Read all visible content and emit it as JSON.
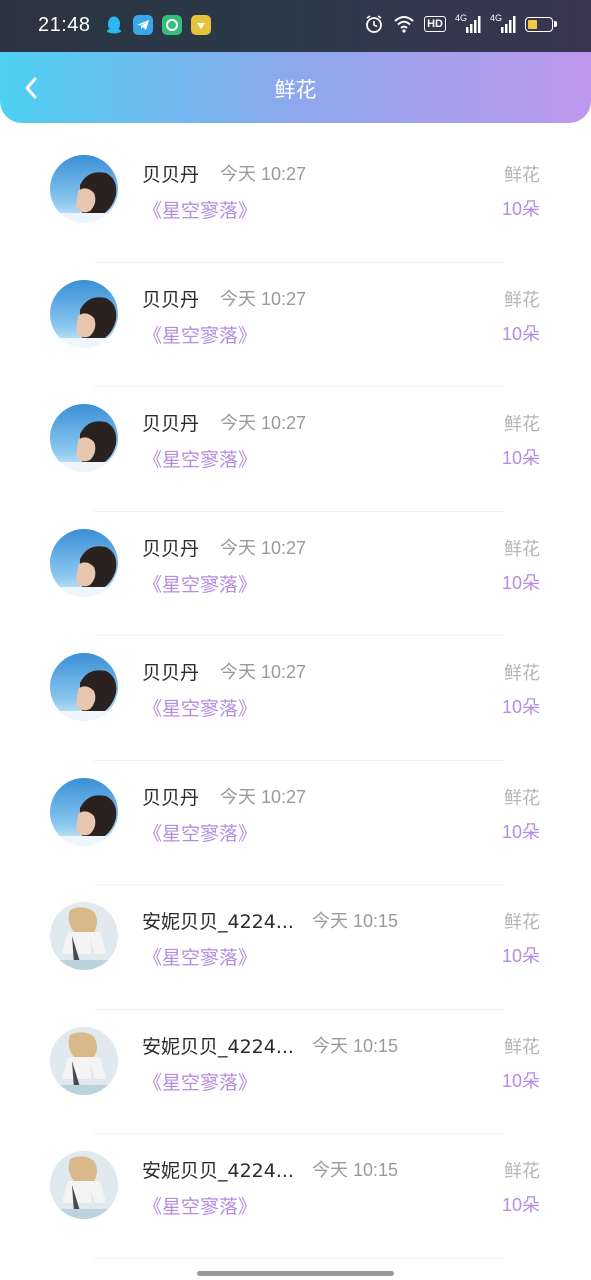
{
  "status_bar": {
    "time": "21:48",
    "hd_label": "HD",
    "network_label_1": "4G",
    "network_label_2": "4G",
    "battery_level": 0.4
  },
  "header": {
    "title": "鲜花",
    "back_icon": "chevron-left-icon"
  },
  "items": [
    {
      "name": "贝贝丹",
      "time": "今天 10:27",
      "work": "《星空寥落》",
      "gift_type": "鲜花",
      "gift_count": "10朵",
      "avatar": "sky"
    },
    {
      "name": "贝贝丹",
      "time": "今天 10:27",
      "work": "《星空寥落》",
      "gift_type": "鲜花",
      "gift_count": "10朵",
      "avatar": "sky"
    },
    {
      "name": "贝贝丹",
      "time": "今天 10:27",
      "work": "《星空寥落》",
      "gift_type": "鲜花",
      "gift_count": "10朵",
      "avatar": "sky"
    },
    {
      "name": "贝贝丹",
      "time": "今天 10:27",
      "work": "《星空寥落》",
      "gift_type": "鲜花",
      "gift_count": "10朵",
      "avatar": "sky"
    },
    {
      "name": "贝贝丹",
      "time": "今天 10:27",
      "work": "《星空寥落》",
      "gift_type": "鲜花",
      "gift_count": "10朵",
      "avatar": "sky"
    },
    {
      "name": "贝贝丹",
      "time": "今天 10:27",
      "work": "《星空寥落》",
      "gift_type": "鲜花",
      "gift_count": "10朵",
      "avatar": "sky"
    },
    {
      "name": "安妮贝贝_4224...",
      "time": "今天 10:15",
      "work": "《星空寥落》",
      "gift_type": "鲜花",
      "gift_count": "10朵",
      "avatar": "girl"
    },
    {
      "name": "安妮贝贝_4224...",
      "time": "今天 10:15",
      "work": "《星空寥落》",
      "gift_type": "鲜花",
      "gift_count": "10朵",
      "avatar": "girl"
    },
    {
      "name": "安妮贝贝_4224...",
      "time": "今天 10:15",
      "work": "《星空寥落》",
      "gift_type": "鲜花",
      "gift_count": "10朵",
      "avatar": "girl"
    }
  ],
  "colors": {
    "accent_purple": "#b58de0",
    "nav_gradient_start": "#4dd0f2",
    "nav_gradient_end": "#be98ee"
  }
}
